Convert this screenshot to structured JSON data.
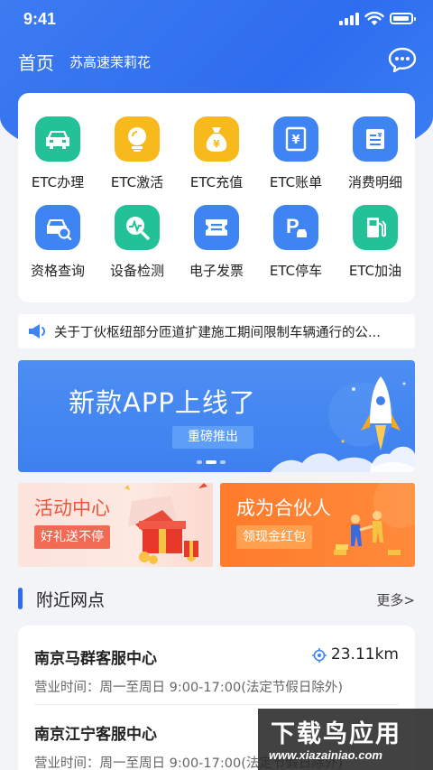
{
  "status": {
    "time": "9:41"
  },
  "header": {
    "home": "首页",
    "subtitle": "苏高速茉莉花"
  },
  "services": [
    {
      "label": "ETC办理",
      "icon": "car-icon",
      "color": "#22c197"
    },
    {
      "label": "ETC激活",
      "icon": "activate-icon",
      "color": "#f8b91c"
    },
    {
      "label": "ETC充值",
      "icon": "money-bag-icon",
      "color": "#f8b91c"
    },
    {
      "label": "ETC账单",
      "icon": "bill-icon",
      "color": "#3e84f2"
    },
    {
      "label": "消费明细",
      "icon": "receipt-icon",
      "color": "#3e84f2"
    },
    {
      "label": "资格查询",
      "icon": "car-search-icon",
      "color": "#3e84f2"
    },
    {
      "label": "设备检测",
      "icon": "device-check-icon",
      "color": "#22c197"
    },
    {
      "label": "电子发票",
      "icon": "ticket-icon",
      "color": "#3e84f2"
    },
    {
      "label": "ETC停车",
      "icon": "parking-icon",
      "color": "#3e84f2"
    },
    {
      "label": "ETC加油",
      "icon": "fuel-icon",
      "color": "#22c197"
    }
  ],
  "notice": {
    "text": "关于丁伙枢纽部分匝道扩建施工期间限制车辆通行的公..."
  },
  "banner": {
    "title": "新款APP上线了",
    "button": "重磅推出"
  },
  "promos": [
    {
      "title": "活动中心",
      "tag": "好礼送不停"
    },
    {
      "title": "成为合伙人",
      "tag": "领现金红包"
    }
  ],
  "nearby": {
    "title": "附近网点",
    "more": "更多>",
    "items": [
      {
        "name": "南京马群客服中心",
        "distance": "23.11km",
        "hours": "营业时间：周一至周日 9:00-17:00(法定节假日除外)"
      },
      {
        "name": "南京江宁客服中心",
        "distance": "",
        "hours": "营业时间：周一至周日 9:00-17:00(法定节假日除外)"
      }
    ]
  },
  "watermark": {
    "big": "下载鸟应用",
    "small": "www.xiazainiao.com"
  }
}
